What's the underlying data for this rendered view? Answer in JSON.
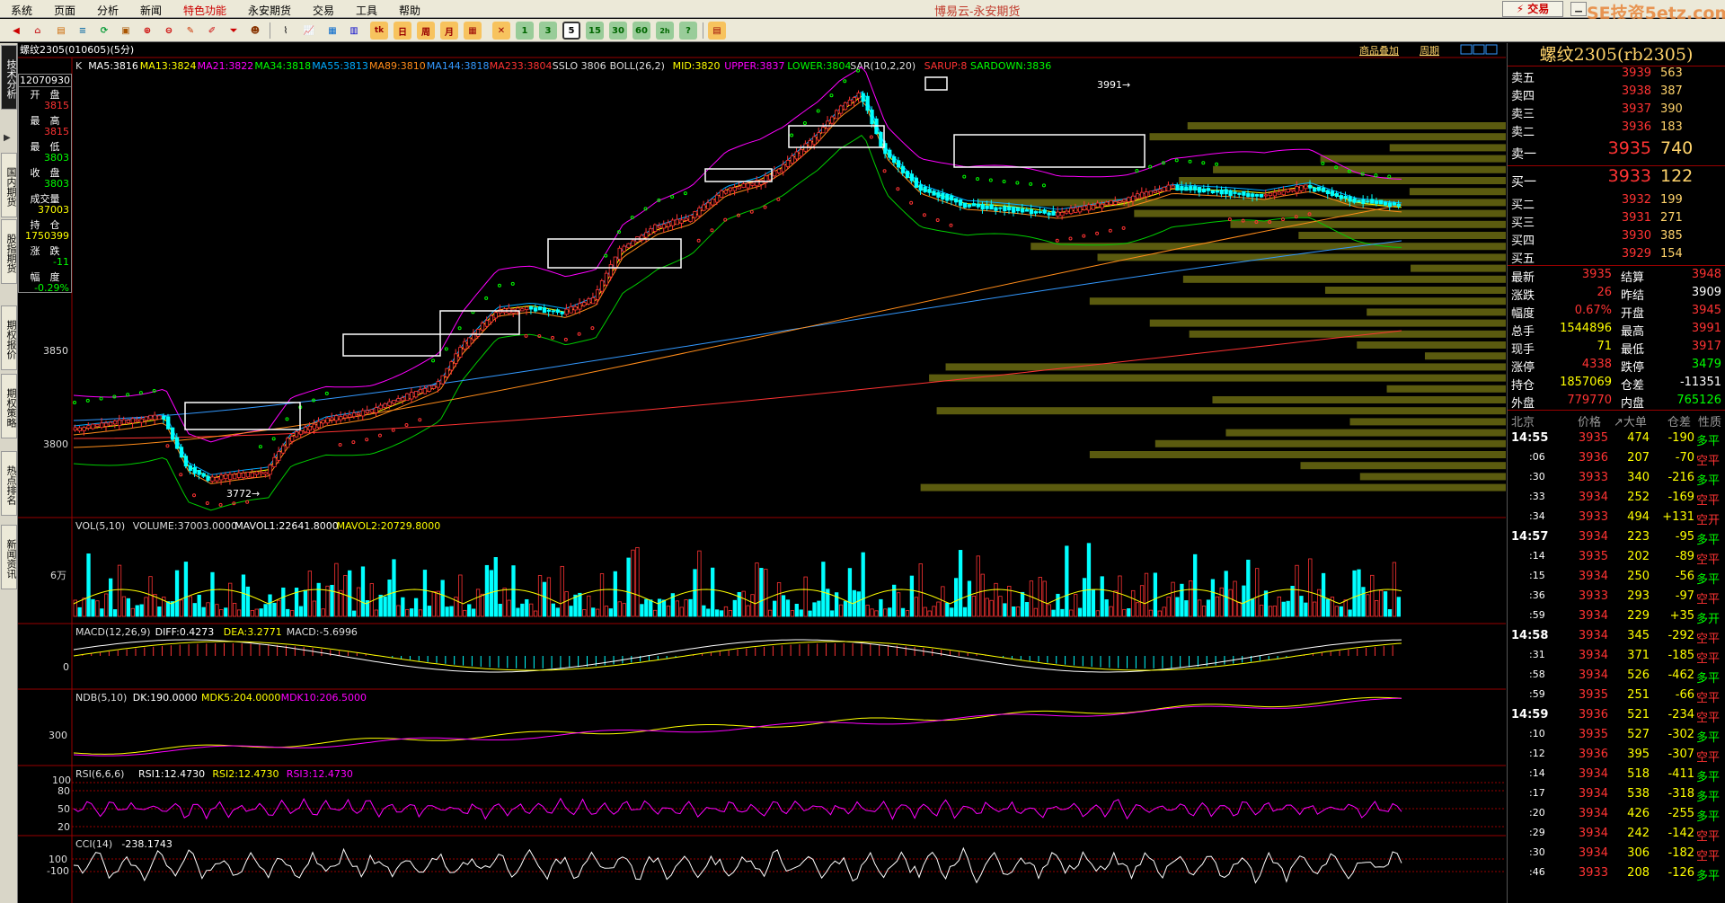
{
  "app": {
    "title": "博易云-永安期货",
    "trade_button": "⚡ 交易",
    "watermark": "SE技资5etz.com"
  },
  "menu": [
    "系统",
    "页面",
    "分析",
    "新闻",
    "特色功能",
    "永安期货",
    "交易",
    "工具",
    "帮助"
  ],
  "toolbar_numbers": [
    "1",
    "5",
    "15",
    "30",
    "60",
    "日",
    "周",
    "月"
  ],
  "side_tabs": [
    "技术分析",
    "国内期货",
    "股指期货",
    "期权报价",
    "期权策略",
    "热点排名",
    "新闻资讯"
  ],
  "chart_header": {
    "title": "螺纹2305(010605)(5分)",
    "link1": "商品叠加",
    "link2": "周期"
  },
  "main_panel": {
    "indicator_line": [
      {
        "t": "K",
        "c": "#dddddd"
      },
      {
        "t": "MA5:3816",
        "c": "#ffffff"
      },
      {
        "t": "MA13:3824",
        "c": "#ffff00"
      },
      {
        "t": "MA21:3822",
        "c": "#ff00ff"
      },
      {
        "t": "MA34:3818",
        "c": "#00ff00"
      },
      {
        "t": "MA55:3813",
        "c": "#00aaff"
      },
      {
        "t": "MA89:3810",
        "c": "#ff8c1a"
      },
      {
        "t": "MA144:3818",
        "c": "#3399ff"
      },
      {
        "t": "MA233:3804",
        "c": "#ff3333"
      },
      {
        "t": "SSLO 3806",
        "c": "#dddddd"
      },
      {
        "t": "BOLL(26,2)",
        "c": "#dddddd"
      },
      {
        "t": "MID:3820",
        "c": "#ffff00"
      },
      {
        "t": "UPPER:3837",
        "c": "#ff00ff"
      },
      {
        "t": "LOWER:3804",
        "c": "#00ff00"
      },
      {
        "t": "SAR(10,2,20)",
        "c": "#dddddd"
      },
      {
        "t": "SARUP:8",
        "c": "#ff3333"
      },
      {
        "t": "SARDOWN:3836",
        "c": "#00ff00"
      }
    ],
    "y_labels": [
      "3850",
      "3800"
    ],
    "hi_label": "3991→",
    "lo_label": "3772→"
  },
  "info_box": {
    "header": "12070930",
    "rows": [
      {
        "k": "开　盘",
        "v": "3815",
        "c": "#ff3333"
      },
      {
        "k": "最　高",
        "v": "3815",
        "c": "#ff3333"
      },
      {
        "k": "最　低",
        "v": "3803",
        "c": "#00ff00"
      },
      {
        "k": "收　盘",
        "v": "3803",
        "c": "#00ff00"
      },
      {
        "k": "成交量",
        "v": "37003",
        "c": "#ffff00"
      },
      {
        "k": "持　仓",
        "v": "1750399",
        "c": "#ffff00"
      },
      {
        "k": "涨　跌",
        "v": "-11",
        "c": "#00ff00"
      },
      {
        "k": "幅　度",
        "v": "-0.29%",
        "c": "#00ff00"
      }
    ]
  },
  "vol_panel": {
    "line": [
      {
        "t": "VOL(5,10)",
        "c": "#dddddd"
      },
      {
        "t": "VOLUME:37003.0000",
        "c": "#dddddd"
      },
      {
        "t": "MAVOL1:22641.8000",
        "c": "#ffffff"
      },
      {
        "t": "MAVOL2:20729.8000",
        "c": "#ffff00"
      }
    ],
    "y_label": "6万"
  },
  "macd_panel": {
    "line": [
      {
        "t": "MACD(12,26,9)",
        "c": "#dddddd"
      },
      {
        "t": "DIFF:0.4273",
        "c": "#ffffff"
      },
      {
        "t": "DEA:3.2771",
        "c": "#ffff00"
      },
      {
        "t": "MACD:-5.6996",
        "c": "#dddddd"
      }
    ],
    "y_label": "0"
  },
  "ndb_panel": {
    "line": [
      {
        "t": "NDB(5,10)",
        "c": "#dddddd"
      },
      {
        "t": "DK:190.0000",
        "c": "#ffffff"
      },
      {
        "t": "MDK5:204.0000",
        "c": "#ffff00"
      },
      {
        "t": "MDK10:206.5000",
        "c": "#ff00ff"
      }
    ],
    "y_label": "300"
  },
  "rsi_panel": {
    "line": [
      {
        "t": "RSI(6,6,6)",
        "c": "#dddddd"
      },
      {
        "t": "RSI1:12.4730",
        "c": "#ffffff"
      },
      {
        "t": "RSI2:12.4730",
        "c": "#ffff00"
      },
      {
        "t": "RSI3:12.4730",
        "c": "#ff00ff"
      }
    ],
    "y_labels": [
      "100",
      "80",
      "50",
      "20"
    ]
  },
  "cci_panel": {
    "line": [
      {
        "t": "CCI(14)",
        "c": "#dddddd"
      },
      {
        "t": "-238.1743",
        "c": "#ffffff"
      }
    ],
    "y_labels": [
      "100",
      "-100"
    ]
  },
  "quote": {
    "symbol": "螺纹2305(rb2305)",
    "asks": [
      {
        "label": "卖五",
        "price": "3939",
        "vol": "563"
      },
      {
        "label": "卖四",
        "price": "3938",
        "vol": "387"
      },
      {
        "label": "卖三",
        "price": "3937",
        "vol": "390"
      },
      {
        "label": "卖二",
        "price": "3936",
        "vol": "183"
      }
    ],
    "ask1": {
      "label": "卖一",
      "price": "3935",
      "vol": "740"
    },
    "bid1": {
      "label": "买一",
      "price": "3933",
      "vol": "122"
    },
    "bids": [
      {
        "label": "买二",
        "price": "3932",
        "vol": "199"
      },
      {
        "label": "买三",
        "price": "3931",
        "vol": "271"
      },
      {
        "label": "买四",
        "price": "3930",
        "vol": "385"
      },
      {
        "label": "买五",
        "price": "3929",
        "vol": "154"
      }
    ],
    "stats": [
      {
        "k1": "最新",
        "v1": "3935",
        "c1": "#ff3333",
        "k2": "结算",
        "v2": "3948",
        "c2": "#ff3333"
      },
      {
        "k1": "涨跌",
        "v1": "26",
        "c1": "#ff3333",
        "k2": "昨结",
        "v2": "3909",
        "c2": "#ffffff"
      },
      {
        "k1": "幅度",
        "v1": "0.67%",
        "c1": "#ff3333",
        "k2": "开盘",
        "v2": "3945",
        "c2": "#ff3333"
      },
      {
        "k1": "总手",
        "v1": "1544896",
        "c1": "#ffff00",
        "k2": "最高",
        "v2": "3991",
        "c2": "#ff3333"
      },
      {
        "k1": "现手",
        "v1": "71",
        "c1": "#ffff00",
        "k2": "最低",
        "v2": "3917",
        "c2": "#ff3333"
      },
      {
        "k1": "涨停",
        "v1": "4338",
        "c1": "#ff3333",
        "k2": "跌停",
        "v2": "3479",
        "c2": "#00ff00"
      },
      {
        "k1": "持仓",
        "v1": "1857069",
        "c1": "#ffff00",
        "k2": "仓差",
        "v2": "-11351",
        "c2": "#ffffff"
      },
      {
        "k1": "外盘",
        "v1": "779770",
        "c1": "#ff3333",
        "k2": "内盘",
        "v2": "765126",
        "c2": "#00ff00"
      }
    ],
    "ticks_header": {
      "time": "北京",
      "price": "价格",
      "vol": "↗大单",
      "diff": "仓差",
      "nature": "性质"
    },
    "ticks": [
      {
        "t": "14:55",
        "p": "3935",
        "v": "474",
        "d": "-190",
        "n": "多平"
      },
      {
        "t": ":06",
        "p": "3936",
        "v": "207",
        "d": "-70",
        "n": "空平"
      },
      {
        "t": ":30",
        "p": "3933",
        "v": "340",
        "d": "-216",
        "n": "多平"
      },
      {
        "t": ":33",
        "p": "3934",
        "v": "252",
        "d": "-169",
        "n": "空平"
      },
      {
        "t": ":34",
        "p": "3933",
        "v": "494",
        "d": "+131",
        "n": "空开"
      },
      {
        "t": "14:57",
        "p": "3934",
        "v": "223",
        "d": "-95",
        "n": "多平"
      },
      {
        "t": ":14",
        "p": "3935",
        "v": "202",
        "d": "-89",
        "n": "空平"
      },
      {
        "t": ":15",
        "p": "3934",
        "v": "250",
        "d": "-56",
        "n": "多平"
      },
      {
        "t": ":36",
        "p": "3933",
        "v": "293",
        "d": "-97",
        "n": "空平"
      },
      {
        "t": ":59",
        "p": "3934",
        "v": "229",
        "d": "+35",
        "n": "多开"
      },
      {
        "t": "14:58",
        "p": "3934",
        "v": "345",
        "d": "-292",
        "n": "空平"
      },
      {
        "t": ":31",
        "p": "3934",
        "v": "371",
        "d": "-185",
        "n": "空平"
      },
      {
        "t": ":58",
        "p": "3934",
        "v": "526",
        "d": "-462",
        "n": "多平"
      },
      {
        "t": ":59",
        "p": "3935",
        "v": "251",
        "d": "-66",
        "n": "空平"
      },
      {
        "t": "14:59",
        "p": "3936",
        "v": "521",
        "d": "-234",
        "n": "空平"
      },
      {
        "t": ":10",
        "p": "3935",
        "v": "527",
        "d": "-302",
        "n": "多平"
      },
      {
        "t": ":12",
        "p": "3936",
        "v": "395",
        "d": "-307",
        "n": "空平"
      },
      {
        "t": ":14",
        "p": "3934",
        "v": "518",
        "d": "-411",
        "n": "多平"
      },
      {
        "t": ":17",
        "p": "3934",
        "v": "538",
        "d": "-318",
        "n": "多平"
      },
      {
        "t": ":20",
        "p": "3934",
        "v": "426",
        "d": "-255",
        "n": "多平"
      },
      {
        "t": ":29",
        "p": "3934",
        "v": "242",
        "d": "-142",
        "n": "空平"
      },
      {
        "t": ":30",
        "p": "3934",
        "v": "306",
        "d": "-182",
        "n": "空平"
      },
      {
        "t": ":46",
        "p": "3933",
        "v": "208",
        "d": "-126",
        "n": "多平"
      }
    ]
  }
}
